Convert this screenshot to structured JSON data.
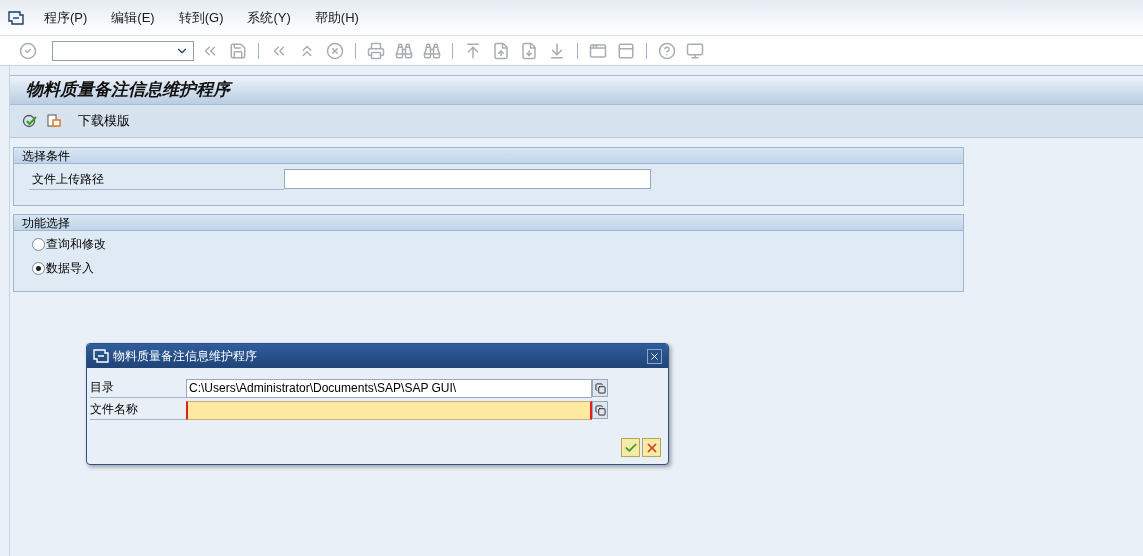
{
  "menu": [
    {
      "label": "程序(P)"
    },
    {
      "label": "编辑(E)"
    },
    {
      "label": "转到(G)"
    },
    {
      "label": "系统(Y)"
    },
    {
      "label": "帮助(H)"
    }
  ],
  "title": "物料质量备注信息维护程序",
  "app_toolbar": {
    "download_label": "下载模版"
  },
  "sections": [
    {
      "title": "选择条件",
      "kind": "fields",
      "fields": [
        {
          "label": "文件上传路径"
        }
      ]
    },
    {
      "title": "功能选择",
      "kind": "radios",
      "options": [
        {
          "label": "查询和修改",
          "selected": false
        },
        {
          "label": "数据导入",
          "selected": true
        }
      ]
    }
  ],
  "dialog": {
    "title": "物料质量备注信息维护程序",
    "fields": [
      {
        "label": "目录",
        "value": "C:\\Users\\Administrator\\Documents\\SAP\\SAP GUI\\",
        "required": false
      },
      {
        "label": "文件名称",
        "required": true
      }
    ]
  }
}
